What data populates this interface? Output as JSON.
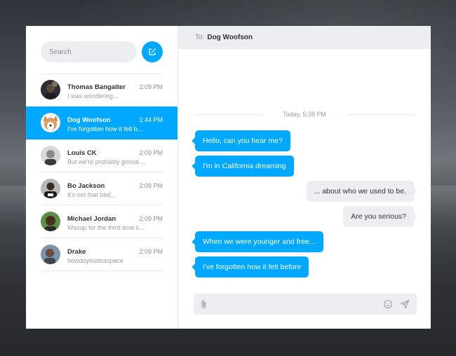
{
  "search": {
    "placeholder": "Search"
  },
  "contacts": [
    {
      "name": "Thomas Bangalter",
      "time": "2:09 PM",
      "preview": "I was wondering..."
    },
    {
      "name": "Dog Woofson",
      "time": "1:44 PM",
      "preview": "I've forgotten how it felt b..."
    },
    {
      "name": "Louis CK",
      "time": "2:09 PM",
      "preview": "But we're probably gonna ..."
    },
    {
      "name": "Bo Jackson",
      "time": "2:09 PM",
      "preview": "It's not that bad..."
    },
    {
      "name": "Michael Jordan",
      "time": "2:09 PM",
      "preview": "Wasup for the third time li..."
    },
    {
      "name": "Drake",
      "time": "2:09 PM",
      "preview": "howdoyoudoaspace"
    }
  ],
  "chat": {
    "to_label": "To:",
    "to_name": "Dog Woofson",
    "date_divider": "Today, 5:38 PM",
    "messages": [
      {
        "from": "you",
        "text": "Hello, can you hear me?"
      },
      {
        "from": "you",
        "text": "I'm in California dreaming"
      },
      {
        "from": "me",
        "text": "... about who we used to be."
      },
      {
        "from": "me",
        "text": "Are you serious?"
      },
      {
        "from": "you",
        "text": "When we were younger and free..."
      },
      {
        "from": "you",
        "text": "I've forgotten how it felt before"
      }
    ],
    "composer_placeholder": ""
  },
  "colors": {
    "accent": "#00a8ff",
    "bubble_me": "#eceef0",
    "text": "#333333"
  },
  "icons": [
    "compose-icon",
    "attachment-icon",
    "emoji-icon",
    "send-icon"
  ]
}
